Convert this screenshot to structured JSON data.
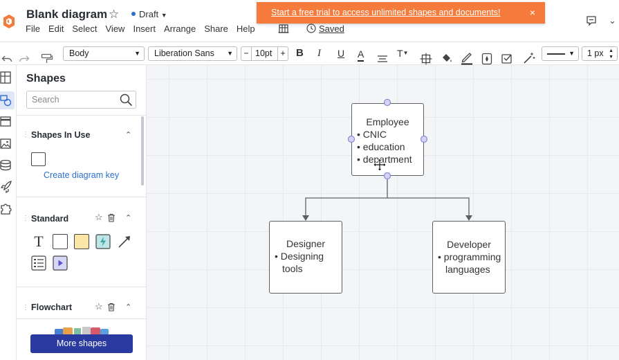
{
  "header": {
    "title": "Blank diagram",
    "status": "Draft",
    "menu": [
      "File",
      "Edit",
      "Select",
      "View",
      "Insert",
      "Arrange",
      "Share",
      "Help"
    ],
    "saved": "Saved",
    "banner_text": "Start a free trial to access unlimited shapes and documents!",
    "banner_close": "×"
  },
  "toolbar": {
    "style_select": "Body",
    "font_select": "Liberation Sans",
    "font_size": "10pt",
    "minus": "−",
    "plus": "+",
    "line_width": "1 px",
    "bold": "B",
    "italic": "I",
    "underline": "U",
    "text_color": "A",
    "text_options": "T"
  },
  "panel": {
    "title": "Shapes",
    "search_placeholder": "Search",
    "sections": [
      {
        "title": "Shapes In Use",
        "link": "Create diagram key"
      },
      {
        "title": "Standard"
      },
      {
        "title": "Flowchart"
      }
    ],
    "more_shapes": "More shapes",
    "text_shape_glyph": "T"
  },
  "diagram": {
    "root": {
      "title": "Employee",
      "bullets": [
        "CNIC",
        "education",
        "department"
      ]
    },
    "children": [
      {
        "title": "Designer",
        "bullet": "Designing",
        "cont": "tools"
      },
      {
        "title": "Developer",
        "bullet": "programming",
        "cont": "languages"
      }
    ]
  },
  "colors": {
    "banner": "#f47b3b",
    "accent_blue": "#2d6ed0",
    "more_shapes_button": "#2b3aa0",
    "logo": "#f47b3b",
    "handle": "#8a86d8"
  }
}
